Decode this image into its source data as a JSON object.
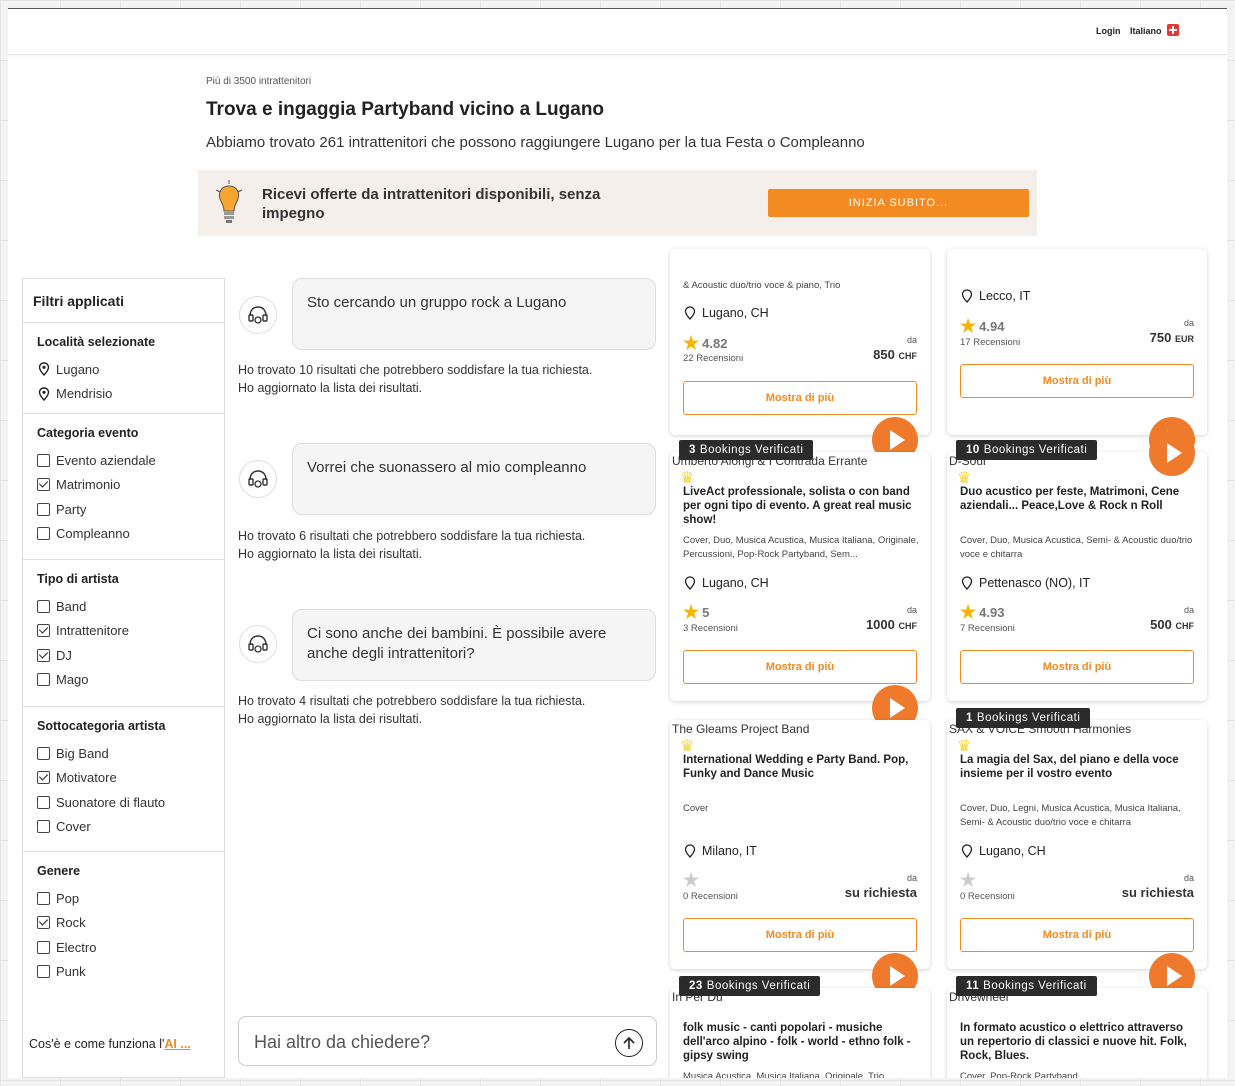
{
  "nav": {
    "login": "Login",
    "language": "Italiano"
  },
  "header": {
    "subtitle": "Più di 3500 intrattenitori",
    "title": "Trova e ingaggia Partyband vicino a Lugano",
    "lead": "Abbiamo trovato 261 intrattenitori che possono raggiungere Lugano per la tua Festa o Compleanno"
  },
  "banner": {
    "text": "Ricevi offerte da intrattenitori disponibili, senza impegno",
    "cta": "INIZIA SUBITO..."
  },
  "sidebar": {
    "title": "Filtri applicati",
    "locations_title": "Località selezionate",
    "locations": [
      "Lugano",
      "Mendrisio"
    ],
    "event_title": "Categoria evento",
    "event": [
      {
        "label": "Evento aziendale",
        "checked": false
      },
      {
        "label": "Matrimonio",
        "checked": true
      },
      {
        "label": "Party",
        "checked": false
      },
      {
        "label": "Compleanno",
        "checked": false
      }
    ],
    "artist_title": "Tipo di artista",
    "artist": [
      {
        "label": "Band",
        "checked": false
      },
      {
        "label": "Intrattenitore",
        "checked": true
      },
      {
        "label": "DJ",
        "checked": true
      },
      {
        "label": "Mago",
        "checked": false
      }
    ],
    "sub_title": "Sottocategoria artista",
    "sub": [
      {
        "label": "Big Band",
        "checked": false
      },
      {
        "label": "Motivatore",
        "checked": true
      },
      {
        "label": "Suonatore di flauto",
        "checked": false
      },
      {
        "label": "Cover",
        "checked": false
      }
    ],
    "genre_title": "Genere",
    "genre": [
      {
        "label": "Pop",
        "checked": false
      },
      {
        "label": "Rock",
        "checked": true
      },
      {
        "label": "Electro",
        "checked": false
      },
      {
        "label": "Punk",
        "checked": false
      }
    ],
    "footer_prefix": "Cos'è e come funziona l'",
    "footer_link": "AI ..."
  },
  "chat": {
    "messages": [
      {
        "question": "Sto cercando un gruppo rock a Lugano",
        "reply1": "Ho trovato 10 risultati che potrebbero soddisfare la tua richiesta.",
        "reply2": "Ho aggiornato la lista dei risultati."
      },
      {
        "question": "Vorrei che suonassero al mio compleanno",
        "reply1": "Ho trovato 6 risultati che potrebbero soddisfare la tua richiesta.",
        "reply2": "Ho aggiornato la lista dei risultati."
      },
      {
        "question": "Ci sono anche dei bambini. È possibile avere anche degli intrattenitori?",
        "reply1": "Ho trovato 4 risultati che potrebbero soddisfare la tua richiesta.",
        "reply2": "Ho aggiornato la lista dei risultati."
      }
    ],
    "input_placeholder": "Hai altro da chiedere?"
  },
  "common": {
    "from": "da",
    "show_more": "Mostra di più",
    "verified_suffix": "Bookings Verificati"
  },
  "cards": [
    {
      "tags": "& Acoustic duo/trio voce & piano, Trio",
      "location": "Lugano, CH",
      "rating": "4.82",
      "reviews": "22 Recensioni",
      "price": "850",
      "currency": "CHF"
    },
    {
      "location": "Lecco, IT",
      "rating": "4.94",
      "reviews": "17 Recensioni",
      "price": "750",
      "currency": "EUR"
    },
    {
      "badge": "3",
      "image_alt": "Umberto Alongi & I Contrada Errante",
      "title": "LiveAct professionale, solista o con band per ogni tipo di evento. A great real music show!",
      "tags": "Cover, Duo, Musica Acustica, Musica Italiana, Originale, Percussioni, Pop-Rock Partyband, Sem...",
      "location": "Lugano, CH",
      "rating": "5",
      "reviews": "3 Recensioni",
      "price": "1000",
      "currency": "CHF"
    },
    {
      "badge": "10",
      "image_alt": "D-Soul",
      "title": "Duo acustico per feste, Matrimoni, Cene aziendali... Peace,Love & Rock n Roll",
      "tags": "Cover, Duo, Musica Acustica, Semi- & Acoustic duo/trio voce e chitarra",
      "location": "Pettenasco (NO), IT",
      "rating": "4.93",
      "reviews": "7 Recensioni",
      "price": "500",
      "currency": "CHF"
    },
    {
      "image_alt": "The Gleams Project Band",
      "title": "International Wedding e Party Band. Pop, Funky and Dance Music",
      "tags": "Cover",
      "location": "Milano, IT",
      "reviews": "0 Recensioni",
      "price_text": "su richiesta"
    },
    {
      "badge": "1",
      "image_alt": "SAX & VOICE Smooth Harmonies",
      "title": "La magia del Sax, del piano e della voce insieme per il vostro evento",
      "tags": "Cover, Duo, Legni, Musica Acustica, Musica Italiana, Semi- & Acoustic duo/trio voce e chitarra",
      "location": "Lugano, CH",
      "reviews": "0 Recensioni",
      "price_text": "su richiesta"
    },
    {
      "badge": "23",
      "image_alt": "In Per Du",
      "title": "folk music - canti popolari - musiche dell'arco alpino - folk - world - ethno folk - gipsy swing",
      "tags": "Musica Acustica, Musica Italiana, Originale, Trio"
    },
    {
      "badge": "11",
      "image_alt": "Drivewheel",
      "title": "In formato acustico o elettrico attraverso un repertorio di classici e nuove hit. Folk, Rock, Blues.",
      "tags": "Cover, Pop-Rock Partyband"
    }
  ],
  "colors": {
    "accent": "#f38b22",
    "play": "#ef7a2c",
    "badge": "#2b2b2b"
  }
}
